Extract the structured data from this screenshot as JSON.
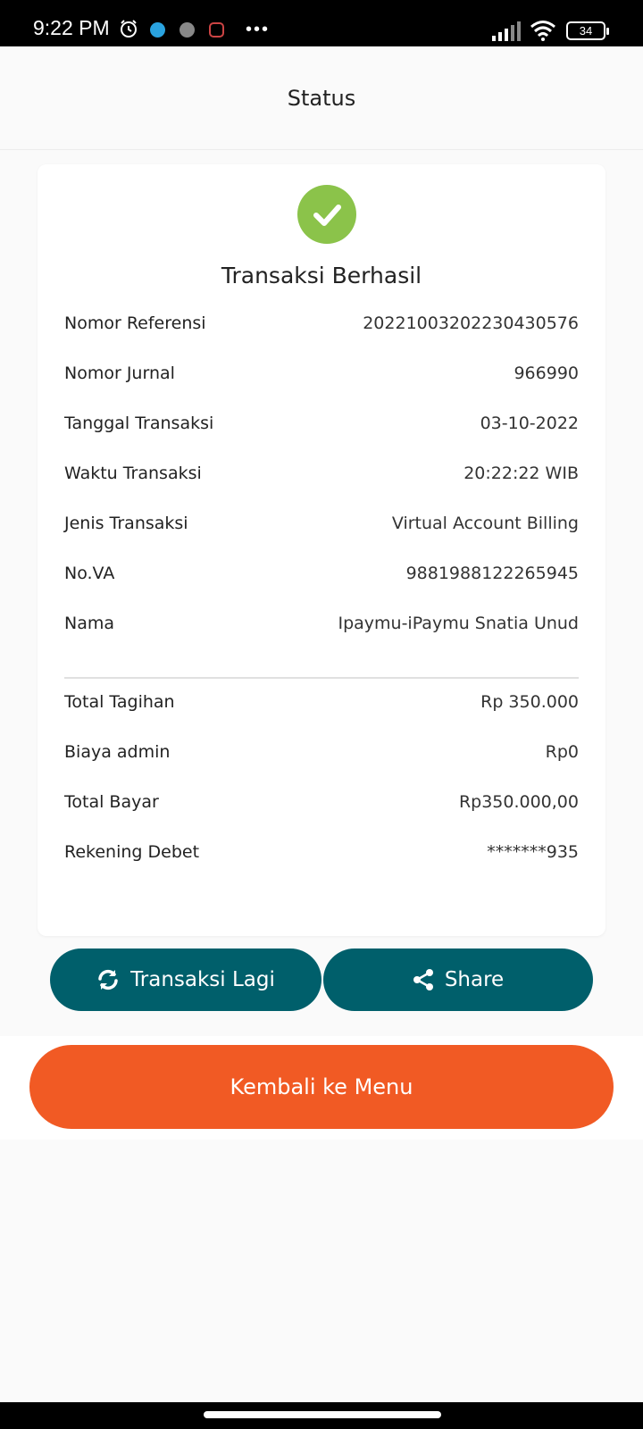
{
  "status_bar": {
    "time": "9:22 PM",
    "dots": "•••",
    "battery": "34"
  },
  "header": {
    "title": "Status"
  },
  "card": {
    "title": "Transaksi Berhasil",
    "details": [
      {
        "label": "Nomor Referensi",
        "value": "20221003202230430576"
      },
      {
        "label": "Nomor Jurnal",
        "value": "966990"
      },
      {
        "label": "Tanggal Transaksi",
        "value": "03-10-2022"
      },
      {
        "label": "Waktu Transaksi",
        "value": "20:22:22 WIB"
      },
      {
        "label": "Jenis Transaksi",
        "value": "Virtual Account Billing"
      },
      {
        "label": "No.VA",
        "value": "9881988122265945"
      },
      {
        "label": "Nama",
        "value": "Ipaymu-iPaymu Snatia Unud"
      }
    ],
    "totals": [
      {
        "label": "Total Tagihan",
        "value": "Rp 350.000"
      },
      {
        "label": "Biaya admin",
        "value": "Rp0"
      },
      {
        "label": "Total Bayar",
        "value": "Rp350.000,00"
      },
      {
        "label": "Rekening Debet",
        "value": "*******935"
      }
    ]
  },
  "buttons": {
    "again": "Transaksi Lagi",
    "share": "Share",
    "back": "Kembali ke Menu"
  },
  "colors": {
    "teal": "#005f6b",
    "orange": "#f15a24",
    "success": "#8bc34a"
  }
}
